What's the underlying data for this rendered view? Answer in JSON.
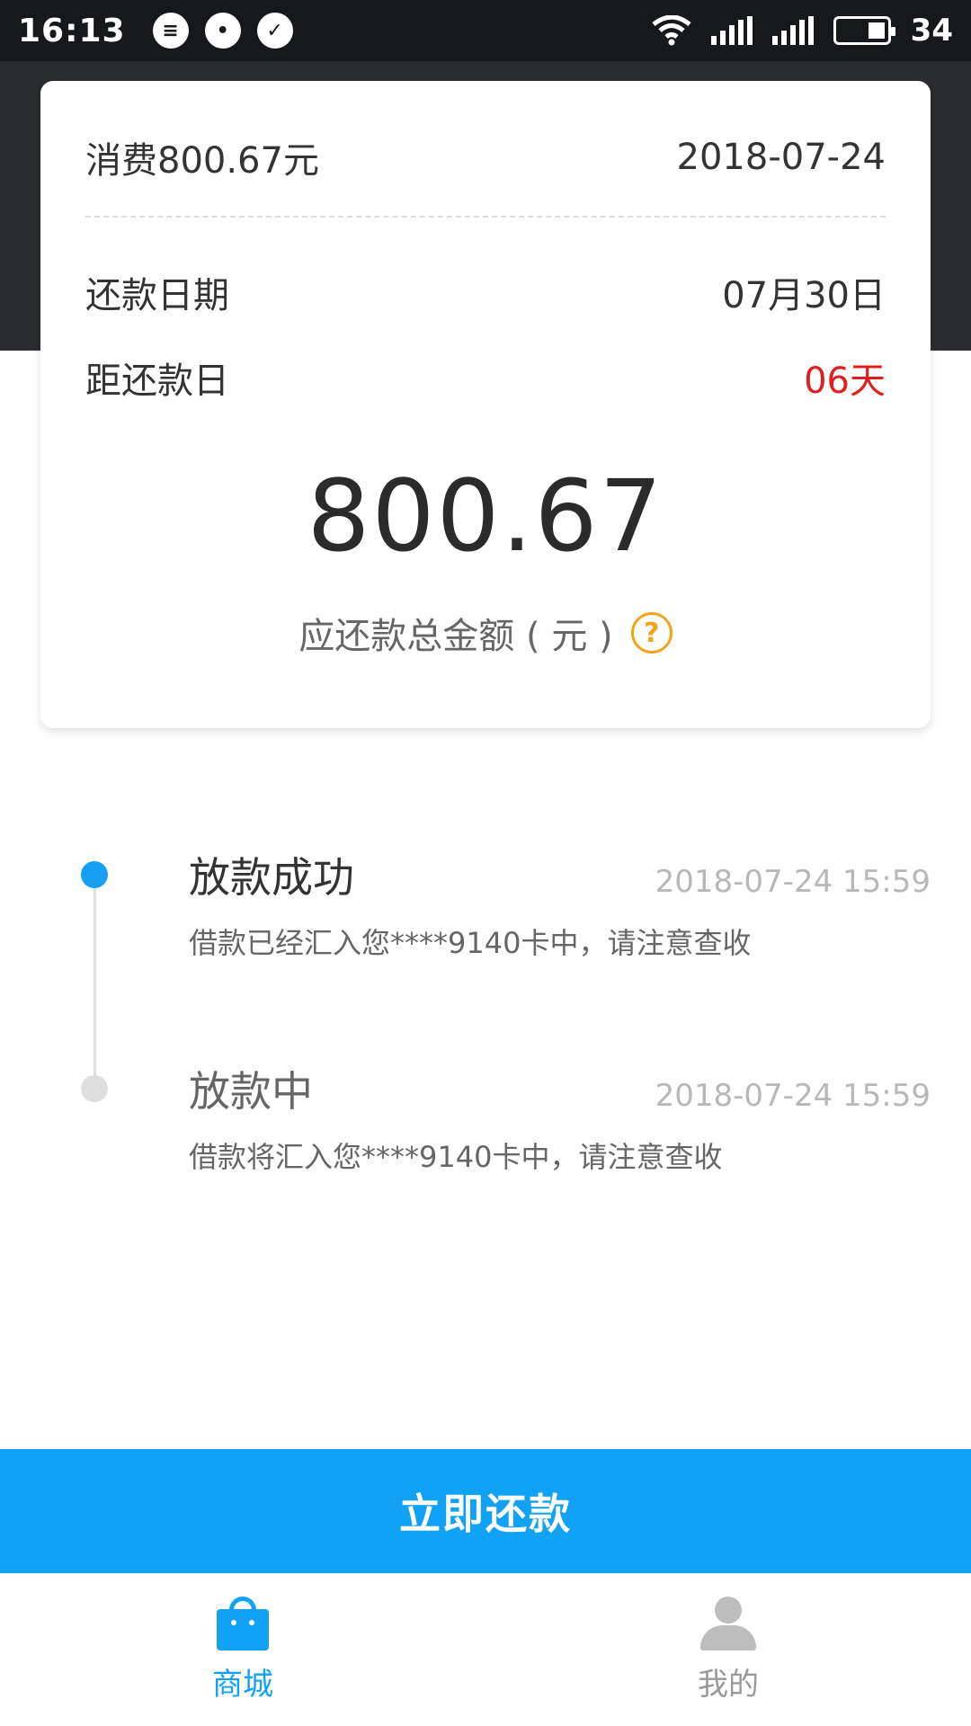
{
  "status_bar": {
    "time": "16:13",
    "battery": "34"
  },
  "card": {
    "consumption": "消费800.67元",
    "date": "2018-07-24",
    "due_label": "还款日期",
    "due_value": "07月30日",
    "days_left_label": "距还款日",
    "days_left_value": "06天",
    "amount": "800.67",
    "amount_label": "应还款总金额 ( 元 )",
    "help_symbol": "?"
  },
  "timeline": [
    {
      "title": "放款成功",
      "time": "2018-07-24 15:59",
      "desc": "借款已经汇入您****9140卡中，请注意查收",
      "state": "active"
    },
    {
      "title": "放款中",
      "time": "2018-07-24 15:59",
      "desc": "借款将汇入您****9140卡中，请注意查收",
      "state": "inactive"
    }
  ],
  "repay_button": "立即还款",
  "bottom_nav": [
    {
      "label": "商城",
      "icon": "shopping-bag-icon",
      "active": true
    },
    {
      "label": "我的",
      "icon": "user-icon",
      "active": false
    }
  ],
  "colors": {
    "accent": "#12a2f5",
    "warning": "#e02020",
    "help": "#f0a51a"
  }
}
